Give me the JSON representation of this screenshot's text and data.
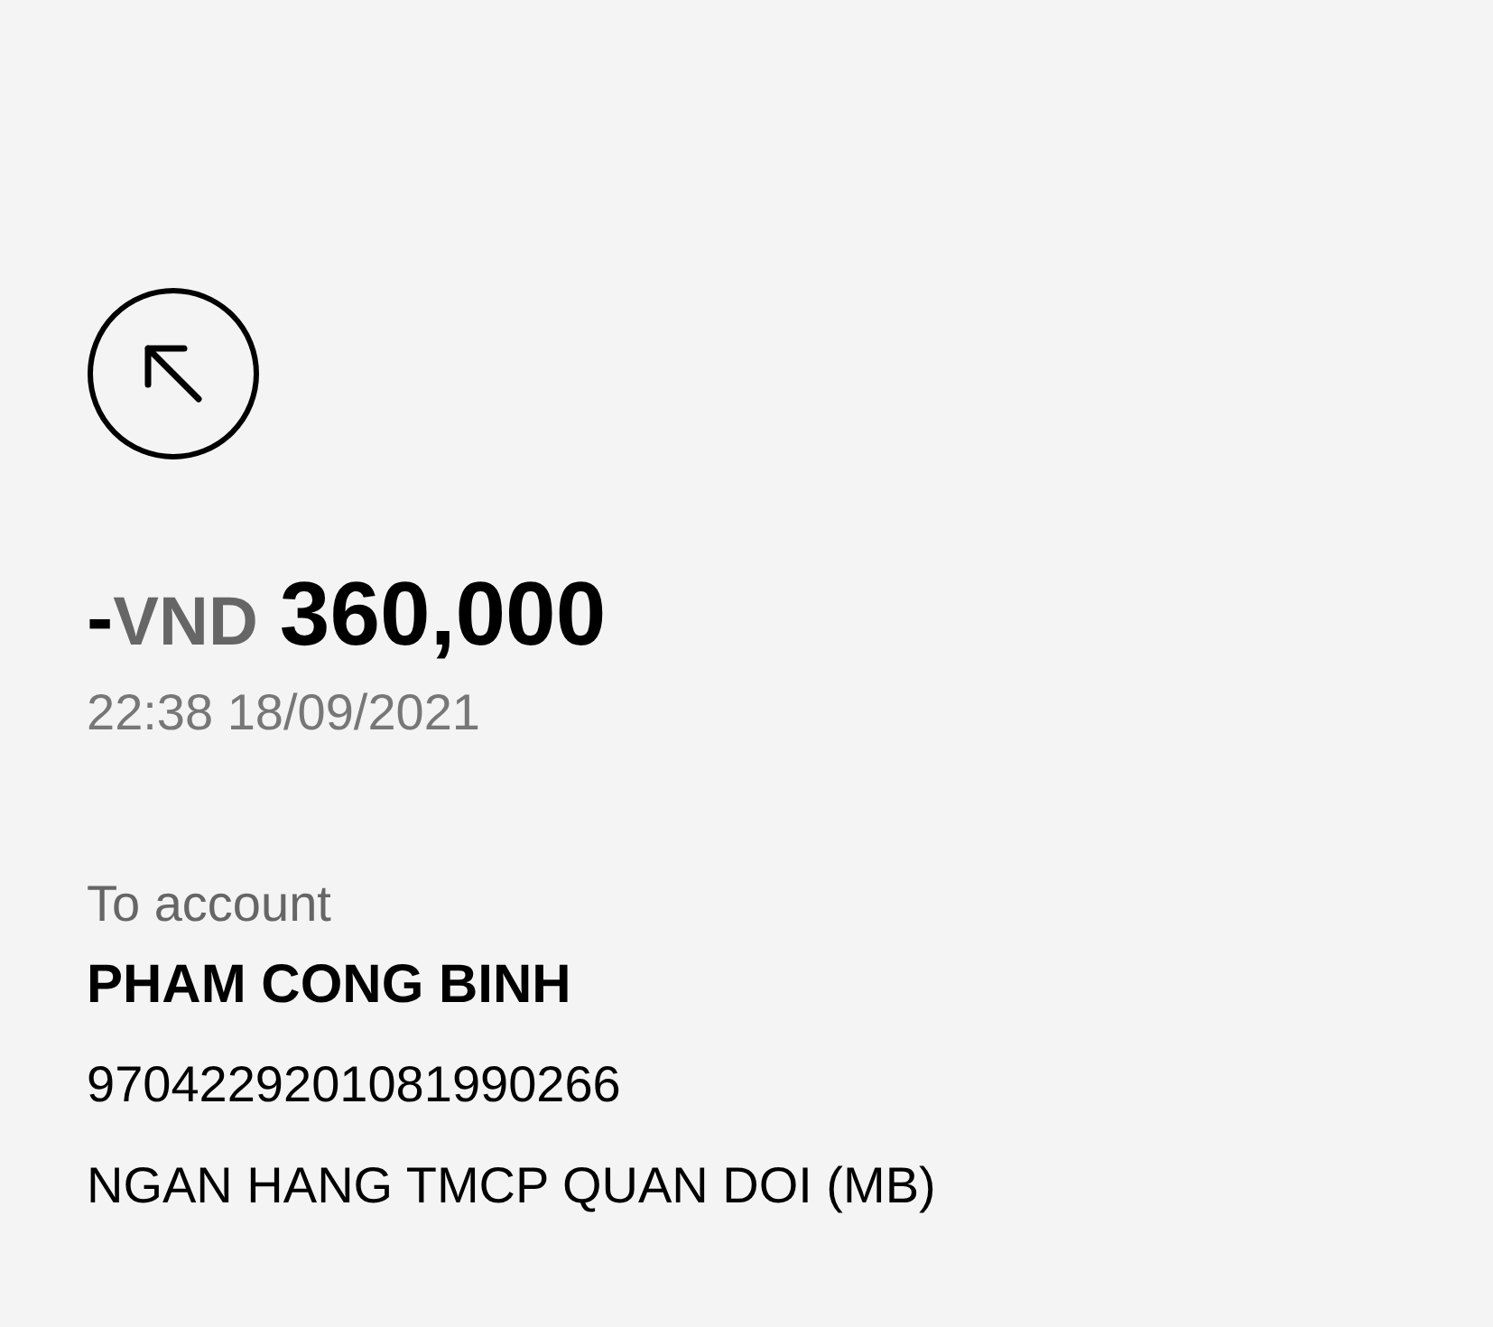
{
  "transaction": {
    "sign": "-",
    "currency": "VND",
    "amount": "360,000",
    "datetime": "22:38 18/09/2021"
  },
  "recipient": {
    "label": "To account",
    "name": "PHAM CONG BINH",
    "account_number": "9704229201081990266",
    "bank": "NGAN HANG TMCP QUAN DOI (MB)"
  }
}
